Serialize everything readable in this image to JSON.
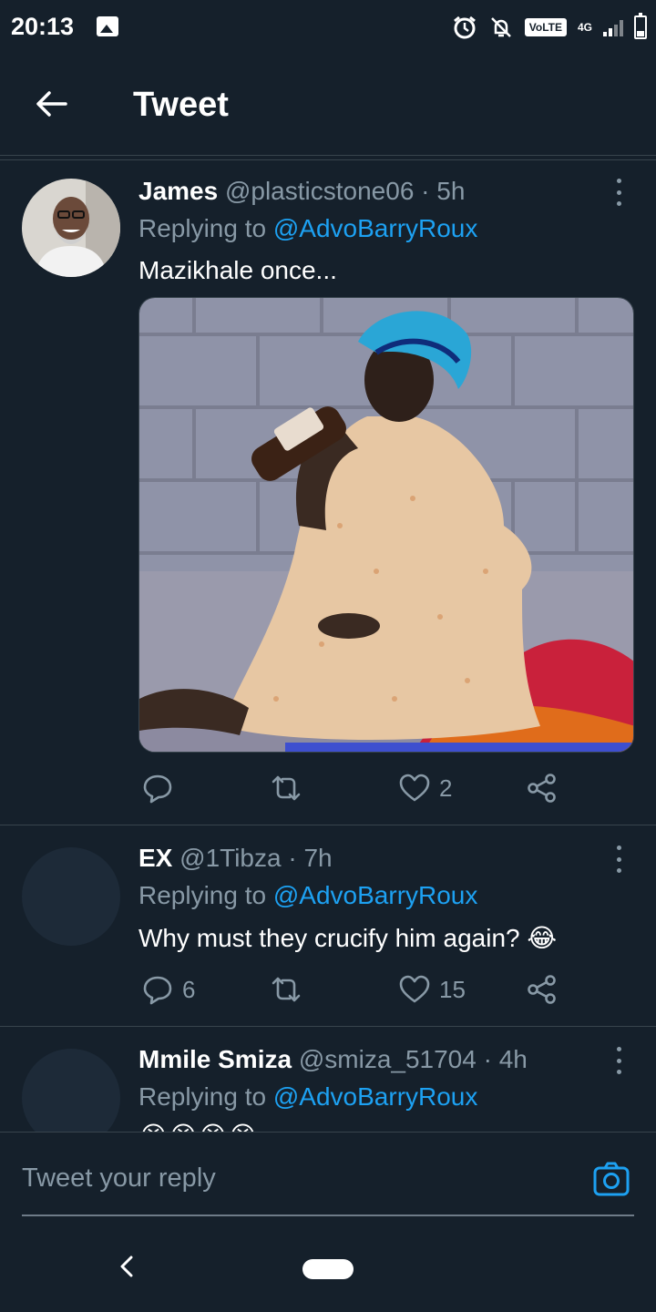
{
  "status_bar": {
    "time": "20:13",
    "volte": "VoLTE",
    "network": "4G"
  },
  "header": {
    "title": "Tweet"
  },
  "tweets": [
    {
      "name": "James",
      "meta": "@plasticstone06 · 5h",
      "replying_prefix": "Replying to",
      "replying_handle": "@AdvoBarryRoux",
      "text": "Mazikhale once...",
      "replies": "",
      "retweets": "",
      "likes": "2"
    },
    {
      "name": "EX",
      "meta": "@1Tibza · 7h",
      "replying_prefix": "Replying to",
      "replying_handle": "@AdvoBarryRoux",
      "text": "Why must they crucify him again? 😂",
      "replies": "6",
      "retweets": "",
      "likes": "15"
    },
    {
      "name": "Mmile Smiza",
      "meta": "@smiza_51704 · 4h",
      "replying_prefix": "Replying to",
      "replying_handle": "@AdvoBarryRoux",
      "text": "😭😭😭😭"
    }
  ],
  "composer": {
    "placeholder": "Tweet your reply"
  },
  "colors": {
    "background": "#15202b",
    "accent": "#1da1f2",
    "muted": "#8899a6",
    "divider": "#38444d"
  }
}
